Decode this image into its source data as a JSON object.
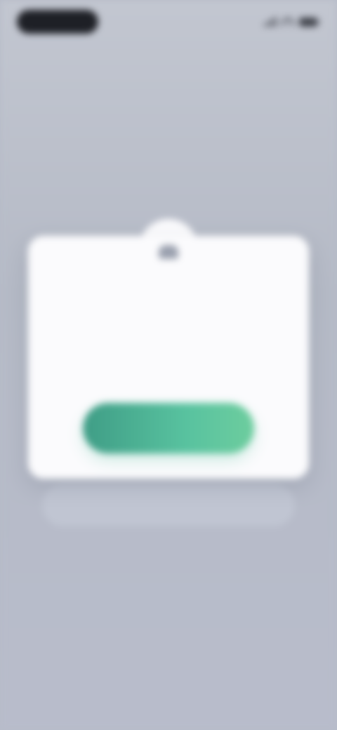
{
  "status_bar": {
    "time": "",
    "icons": [
      "signal-icon",
      "wifi-icon",
      "battery-icon"
    ]
  },
  "modal": {
    "icon": "lock-icon",
    "title": "",
    "message": "",
    "button_label": ""
  },
  "colors": {
    "background": "#b7bcc9",
    "card": "#fbfbfd",
    "button_gradient_start": "#3f9d86",
    "button_gradient_end": "#6dcd9e",
    "status_pill": "#1e2026"
  }
}
